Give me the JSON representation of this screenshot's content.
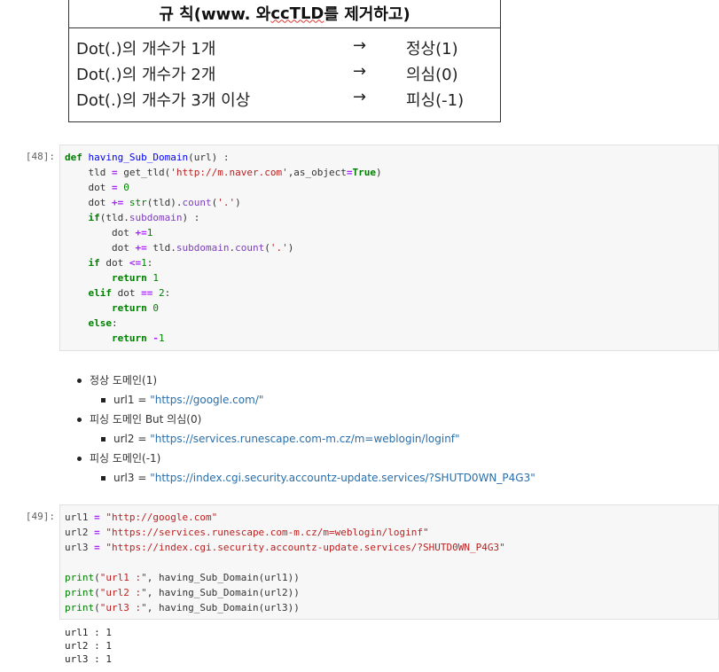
{
  "rule_box": {
    "title_pre": "규 칙(www. 와 ",
    "title_cctld": "ccTLD",
    "title_post": " 를 제거하고)",
    "arrow": "→",
    "rows": [
      {
        "condition": "Dot(.)의 개수가 1개",
        "result": "정상(1)"
      },
      {
        "condition": "Dot(.)의 개수가 2개",
        "result": "의심(0)"
      },
      {
        "condition": "Dot(.)의 개수가 3개 이상",
        "result": "피싱(-1)"
      }
    ]
  },
  "cell1": {
    "prompt": "[48]:",
    "t": {
      "def": "def",
      "fname": "having_Sub_Domain",
      "sig": "(url) :",
      "l2a": "tld ",
      "eq": "=",
      "l2b": " get_tld(",
      "l2url": "'http://m.naver.com'",
      "l2c": ",as_object",
      "l2true": "True",
      "l2d": ")",
      "dot": "dot ",
      "zero": "0",
      "pluseq": "+=",
      "str": "str",
      "l4a": "(tld).",
      "count": "count",
      "l4b": "(",
      "dotlit": "'.'",
      "l4c": ")",
      "if": "if",
      "l5a": "(tld.",
      "subdomain": "subdomain",
      "l5b": ") :",
      "one": "1",
      "l7a": " tld.",
      "l7b": ".",
      "l7c": "(",
      "l7d": ")",
      "le": "<=",
      "colon": ":",
      "return": "return",
      "elif": "elif",
      "eqeq": "==",
      "two": "2",
      "else": "else",
      "minus": "-"
    }
  },
  "markdown": {
    "items": [
      {
        "label": "정상 도메인(1)",
        "sub_prefix": "url1 = ",
        "sub_link": "\"https://google.com/\""
      },
      {
        "label": "피싱 도메인 But 의심(0)",
        "sub_prefix": "url2 = ",
        "sub_link": "\"https://services.runescape.com-m.cz/m=weblogin/loginf\""
      },
      {
        "label": "피싱 도메인(-1)",
        "sub_prefix": "url3 = ",
        "sub_link": "\"https://index.cgi.security.accountz-update.services/?SHUTD0WN_P4G3\""
      }
    ]
  },
  "cell2": {
    "prompt": "[49]:",
    "t": {
      "url1": "url1 ",
      "url2": "url2 ",
      "url3": "url3 ",
      "eq": "=",
      "s1": "\"http://google.com\"",
      "s2": "\"https://services.runescape.com-m.cz/m=weblogin/loginf\"",
      "s3": "\"https://index.cgi.security.accountz-update.services/?SHUTD0WN_P4G3\"",
      "print": "print",
      "p1s": "\"url1 :\"",
      "p2s": "\"url2 :\"",
      "p3s": "\"url3 :\"",
      "call1": ", having_Sub_Domain(url1))",
      "call2": ", having_Sub_Domain(url2))",
      "call3": ", having_Sub_Domain(url3))"
    },
    "output": "url1 : 1\nurl2 : 1\nurl3 : 1"
  }
}
